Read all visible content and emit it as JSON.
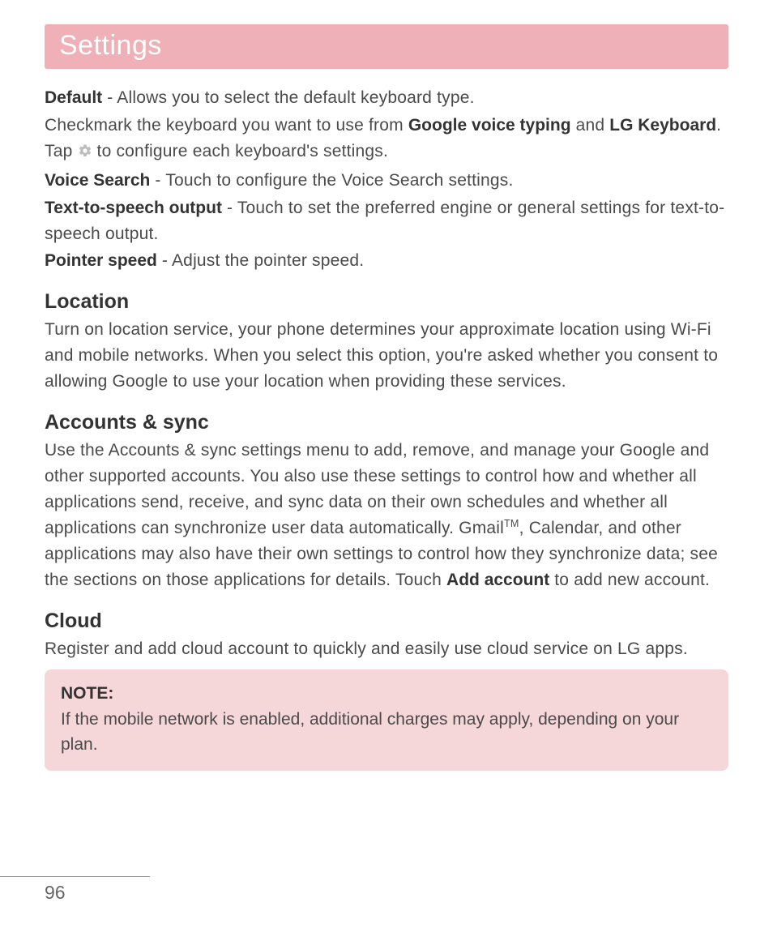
{
  "header": {
    "title": "Settings"
  },
  "intro": {
    "default_label": "Default",
    "default_desc": " - Allows you to select the default keyboard type.",
    "checkmark_pre": "Checkmark the keyboard you want to use from ",
    "google_voice": "Google voice typing",
    "and": " and ",
    "lg_keyboard": "LG Keyboard",
    "tap": ". Tap ",
    "configure_tail": " to configure each keyboard's settings.",
    "voice_search_label": "Voice Search",
    "voice_search_desc": " - Touch to configure the Voice Search settings.",
    "tts_label": "Text-to-speech output",
    "tts_desc": " - Touch to set the preferred engine or general settings for text-to-speech output.",
    "pointer_label": "Pointer speed",
    "pointer_desc": " - Adjust the pointer speed."
  },
  "location": {
    "heading": "Location",
    "body": "Turn on location service, your phone determines your approximate location using Wi-Fi and mobile networks. When you select this option, you're asked whether you consent to allowing Google to use your location when providing these services."
  },
  "accounts": {
    "heading": "Accounts & sync",
    "body_pre": "Use the Accounts & sync settings menu to add, remove, and manage your Google and other supported accounts. You also use these settings to control how and whether all applications send, receive, and sync data on their own schedules and whether all applications can synchronize user data automatically. Gmail",
    "tm": "TM",
    "body_mid": ", Calendar, and other applications may also have their own settings to control how they synchronize data; see the sections on those applications for details. Touch ",
    "add_account": "Add account",
    "body_tail": " to add new account."
  },
  "cloud": {
    "heading": "Cloud",
    "body": "Register and add cloud account to quickly and easily use cloud service on LG apps."
  },
  "note": {
    "label": "NOTE:",
    "body": "If the mobile network is enabled, additional charges may apply, depending on your plan."
  },
  "footer": {
    "page_number": "96"
  }
}
